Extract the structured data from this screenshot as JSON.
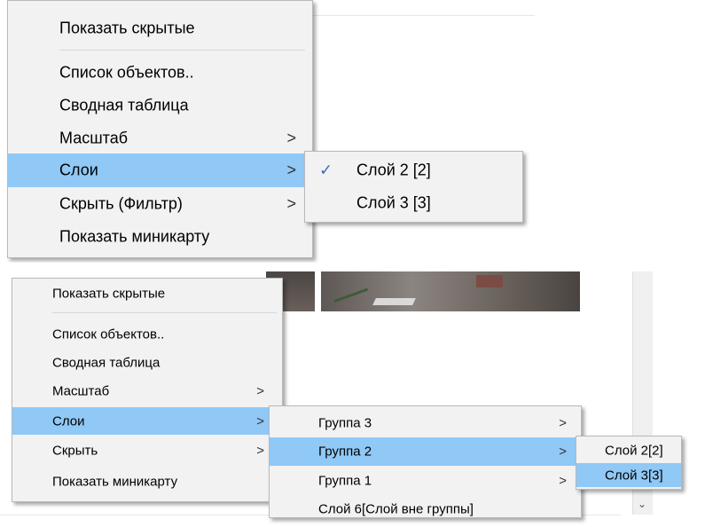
{
  "top_menu": {
    "items": [
      {
        "label": "Показать скрытые"
      },
      {
        "label": "Список объектов.."
      },
      {
        "label": "Сводная таблица"
      },
      {
        "label": "Масштаб",
        "arrow": ">"
      },
      {
        "label": "Слои",
        "arrow": ">"
      },
      {
        "label": "Скрыть (Фильтр)",
        "arrow": ">"
      },
      {
        "label": "Показать миникарту"
      }
    ],
    "submenu": {
      "check": "✓",
      "items": [
        {
          "label": "Слой 2 [2]"
        },
        {
          "label": "Слой 3 [3]"
        }
      ]
    }
  },
  "bottom_menu": {
    "items": [
      {
        "label": "Показать скрытые"
      },
      {
        "label": "Список объектов.."
      },
      {
        "label": "Сводная таблица"
      },
      {
        "label": "Масштаб",
        "arrow": ">"
      },
      {
        "label": "Слои",
        "arrow": ">"
      },
      {
        "label": "Скрыть",
        "arrow": ">"
      },
      {
        "label": "Показать миникарту"
      }
    ],
    "groups_submenu": {
      "items": [
        {
          "label": "Группа 3",
          "arrow": ">"
        },
        {
          "label": "Группа 2",
          "arrow": ">"
        },
        {
          "label": "Группа 1",
          "arrow": ">"
        },
        {
          "label": "Слой 6[Слой вне группы]"
        }
      ]
    },
    "layers_submenu": {
      "items": [
        {
          "label": "Слой 2[2]"
        },
        {
          "label": "Слой 3[3]"
        }
      ]
    },
    "scroll_down_glyph": "⌄"
  },
  "colors": {
    "highlight": "#90c8f6",
    "menu_bg": "#f2f2f2",
    "check": "#3c6fb6"
  }
}
